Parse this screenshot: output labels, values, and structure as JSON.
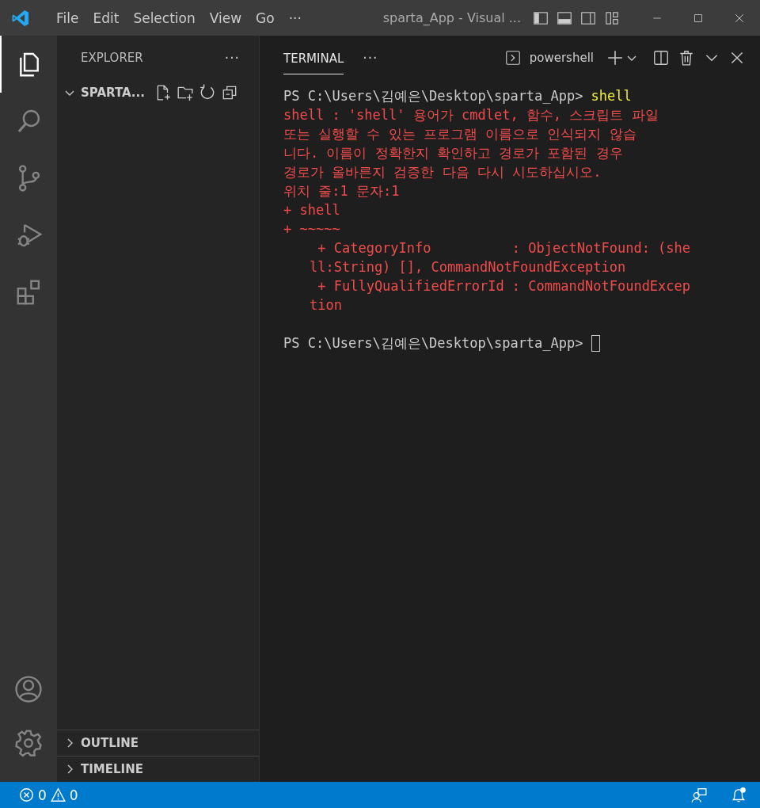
{
  "window": {
    "title": "sparta_App - Visual ...",
    "menu": [
      "File",
      "Edit",
      "Selection",
      "View",
      "Go",
      "···"
    ]
  },
  "activity_bar": [
    {
      "kind": "explorer",
      "selected": true
    },
    {
      "kind": "search",
      "selected": false
    },
    {
      "kind": "source-control",
      "selected": false
    },
    {
      "kind": "run-debug",
      "selected": false
    },
    {
      "kind": "extensions",
      "selected": false
    }
  ],
  "sidebar": {
    "title": "EXPLORER",
    "more": "···",
    "folder": {
      "label": "SPARTA...",
      "expanded": true
    },
    "sections": [
      {
        "label": "OUTLINE",
        "expanded": false
      },
      {
        "label": "TIMELINE",
        "expanded": false
      }
    ]
  },
  "panel": {
    "tabs": [
      {
        "label": "TERMINAL",
        "selected": true
      }
    ],
    "more": "···",
    "shell": "powershell",
    "blocks": [
      {
        "lines": [
          {
            "kind": "input",
            "prompt": "PS C:\\Users\\김예은\\Desktop\\sparta_App>",
            "command": "shell",
            "cursor": false
          },
          {
            "kind": "error",
            "text": "shell : 'shell' 용어가 cmdlet, 함수, 스크립트 파일"
          },
          {
            "kind": "error",
            "text": "또는 실행할 수 있는 프로그램 이름으로 인식되지 않습"
          },
          {
            "kind": "error",
            "text": "니다. 이름이 정확한지 확인하고 경로가 포함된 경우"
          },
          {
            "kind": "error",
            "text": "경로가 올바른지 검증한 다음 다시 시도하십시오."
          },
          {
            "kind": "error",
            "text": "위치 줄:1 문자:1"
          },
          {
            "kind": "error",
            "text": "+ shell"
          },
          {
            "kind": "error",
            "text": "+ ~~~~~"
          },
          {
            "kind": "detail",
            "text": " + CategoryInfo          : ObjectNotFound: (she"
          },
          {
            "kind": "detail",
            "text": "ll:String) [], CommandNotFoundException"
          },
          {
            "kind": "detail",
            "text": " + FullyQualifiedErrorId : CommandNotFoundExcep"
          },
          {
            "kind": "detail",
            "text": "tion"
          }
        ]
      },
      {
        "lines": [
          {
            "kind": "input",
            "prompt": "PS C:\\Users\\김예은\\Desktop\\sparta_App>",
            "cursor": true
          }
        ]
      }
    ]
  },
  "status_bar": {
    "errors": "0",
    "warnings": "0"
  }
}
